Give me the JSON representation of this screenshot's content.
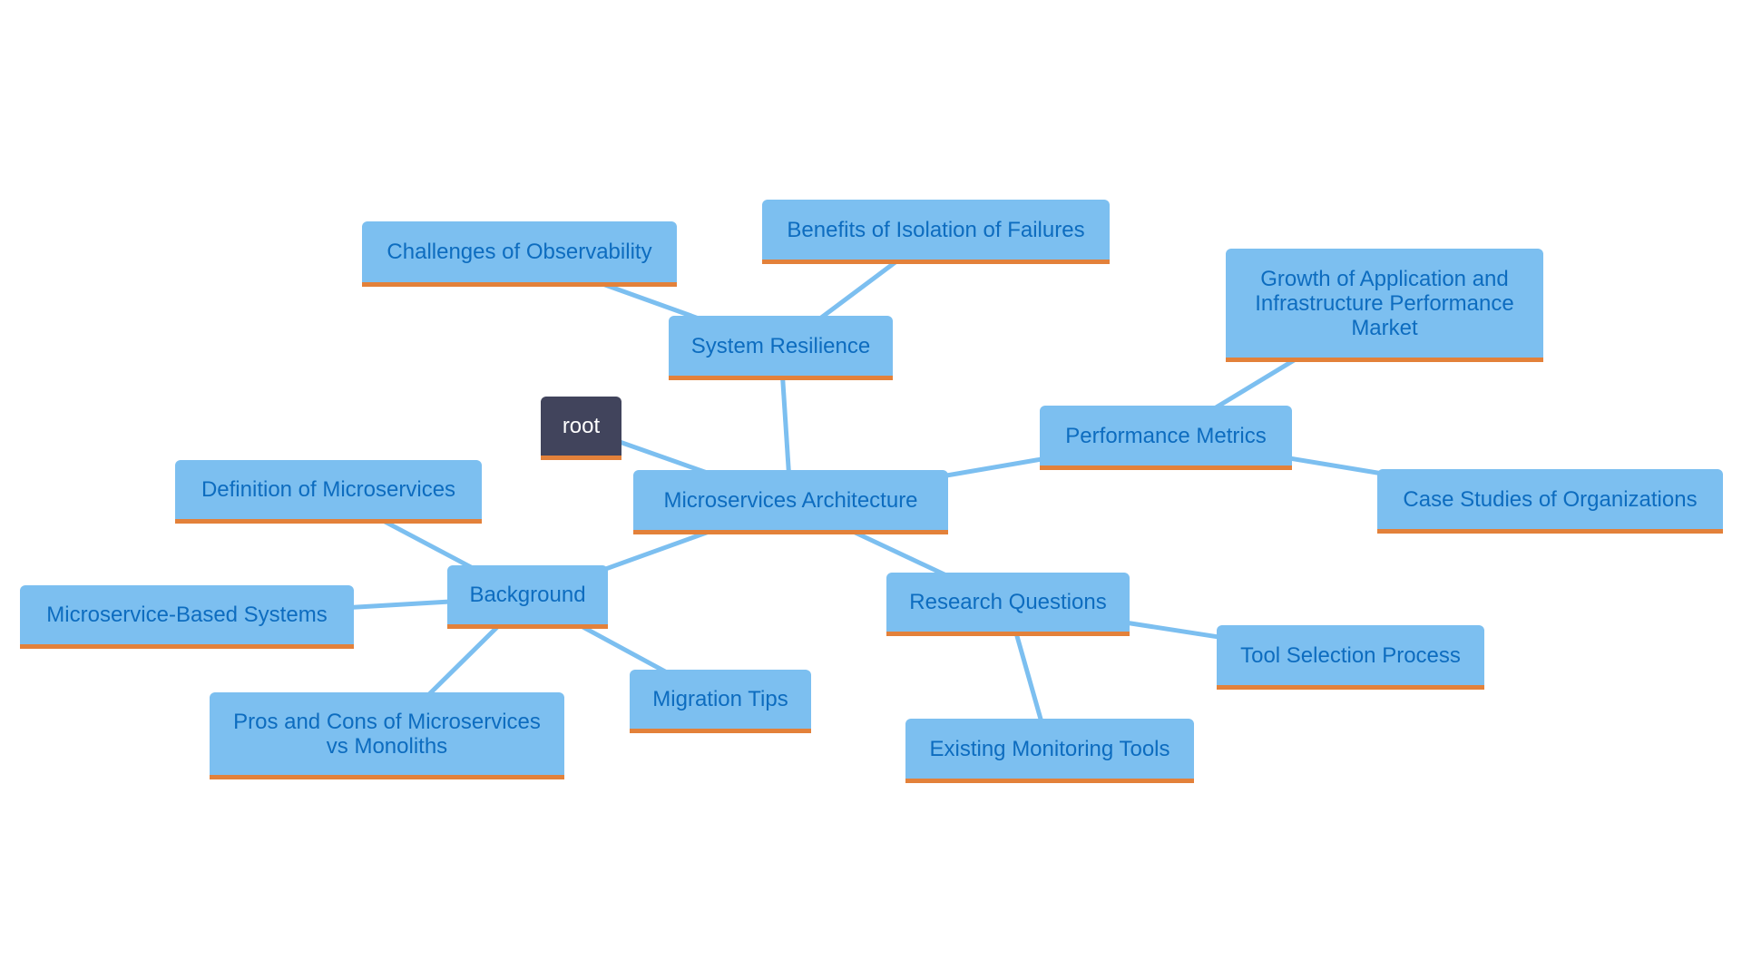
{
  "diagram": {
    "type": "mindmap",
    "colors": {
      "node_fill": "#7cbff0",
      "node_text": "#0d6cbf",
      "node_underline": "#e3813a",
      "root_fill": "#41445c",
      "root_text": "#ffffff",
      "edge": "#7cbff0",
      "background": "#ffffff"
    },
    "nodes": [
      {
        "id": "root",
        "label": "root"
      },
      {
        "id": "arch",
        "label": "Microservices Architecture",
        "parent": "root"
      },
      {
        "id": "resilience",
        "label": "System Resilience",
        "parent": "arch"
      },
      {
        "id": "observability",
        "label": "Challenges of Observability",
        "parent": "resilience"
      },
      {
        "id": "isolation",
        "label": "Benefits of Isolation of Failures",
        "parent": "resilience"
      },
      {
        "id": "perf",
        "label": "Performance Metrics",
        "parent": "arch"
      },
      {
        "id": "growth",
        "label": "Growth of Application and Infrastructure Performance Market",
        "parent": "perf"
      },
      {
        "id": "cases",
        "label": "Case Studies of Organizations",
        "parent": "perf"
      },
      {
        "id": "background",
        "label": "Background",
        "parent": "arch"
      },
      {
        "id": "definition",
        "label": "Definition of Microservices",
        "parent": "background"
      },
      {
        "id": "systems",
        "label": "Microservice-Based Systems",
        "parent": "background"
      },
      {
        "id": "proscons",
        "label": "Pros and Cons of Microservices vs Monoliths",
        "parent": "background"
      },
      {
        "id": "migration",
        "label": "Migration Tips",
        "parent": "background"
      },
      {
        "id": "research",
        "label": "Research Questions",
        "parent": "arch"
      },
      {
        "id": "toolsel",
        "label": "Tool Selection Process",
        "parent": "research"
      },
      {
        "id": "existing",
        "label": "Existing Monitoring Tools",
        "parent": "research"
      }
    ]
  }
}
